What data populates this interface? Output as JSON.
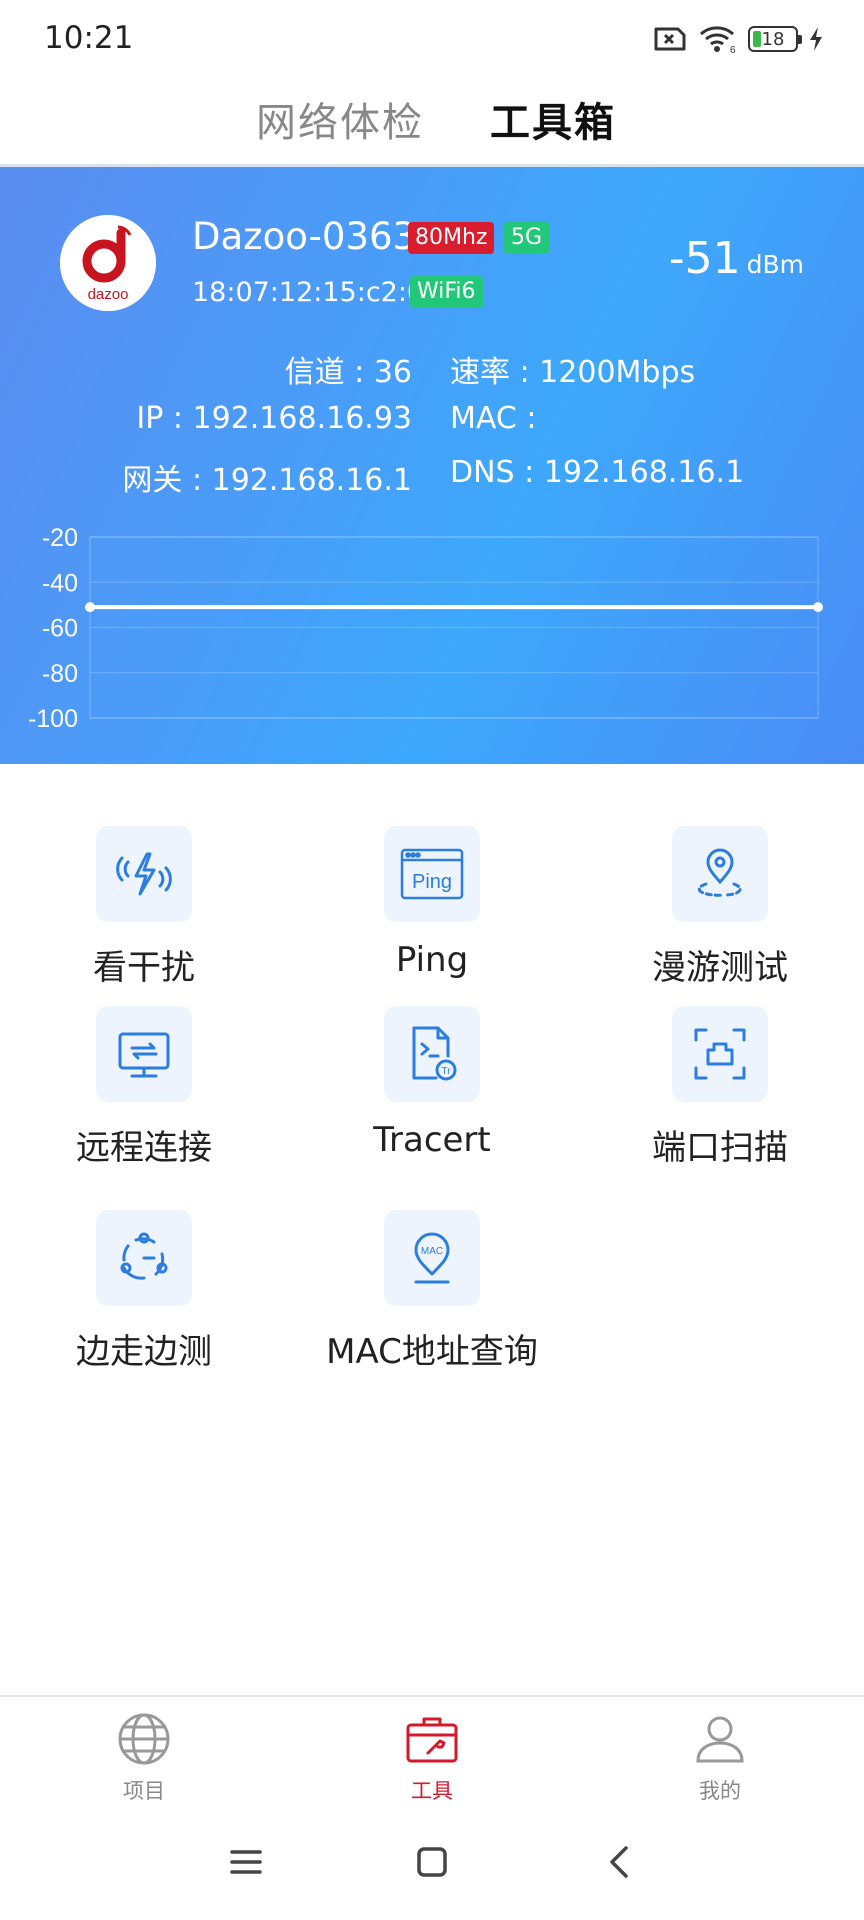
{
  "status_bar": {
    "time": "10:21",
    "battery_level": "18"
  },
  "top_tabs": {
    "inactive_label": "网络体检",
    "active_label": "工具箱"
  },
  "network": {
    "ssid": "Dazoo-0363",
    "bandwidth_badge": "80Mhz",
    "band_badge": "5G",
    "bssid": "18:07:12:15:c2:03",
    "wifi_badge": "WiFi6",
    "signal_value": "-51",
    "signal_unit": "dBm",
    "channel": "信道 : 36",
    "rate": "速率 : 1200Mbps",
    "ip": "IP : 192.168.16.93",
    "mac": "MAC :",
    "gateway": "网关 : 192.168.16.1",
    "dns": "DNS : 192.168.16.1",
    "logo_text": "dazoo"
  },
  "chart_data": {
    "type": "line",
    "y_ticks": [
      "-20",
      "-40",
      "-60",
      "-80",
      "-100"
    ],
    "ylim": [
      -100,
      -20
    ],
    "grid": true,
    "series": [
      {
        "values": [
          -51,
          -51
        ]
      }
    ]
  },
  "tools": [
    {
      "label": "看干扰",
      "icon": "interference-icon"
    },
    {
      "label": "Ping",
      "icon": "ping-icon"
    },
    {
      "label": "漫游测试",
      "icon": "roaming-icon"
    },
    {
      "label": "远程连接",
      "icon": "remote-connect-icon"
    },
    {
      "label": "Tracert",
      "icon": "tracert-icon"
    },
    {
      "label": "端口扫描",
      "icon": "port-scan-icon"
    },
    {
      "label": "边走边测",
      "icon": "walk-test-icon"
    },
    {
      "label": "MAC地址查询",
      "icon": "mac-lookup-icon"
    }
  ],
  "bottom_nav": [
    {
      "label": "项目",
      "icon": "globe-icon"
    },
    {
      "label": "工具",
      "icon": "toolbox-icon"
    },
    {
      "label": "我的",
      "icon": "user-icon"
    }
  ],
  "colors": {
    "accent": "#d21a2a",
    "tool_icon": "#2b7de0",
    "hero_start": "#5b8df0",
    "hero_end": "#3da8fb"
  }
}
